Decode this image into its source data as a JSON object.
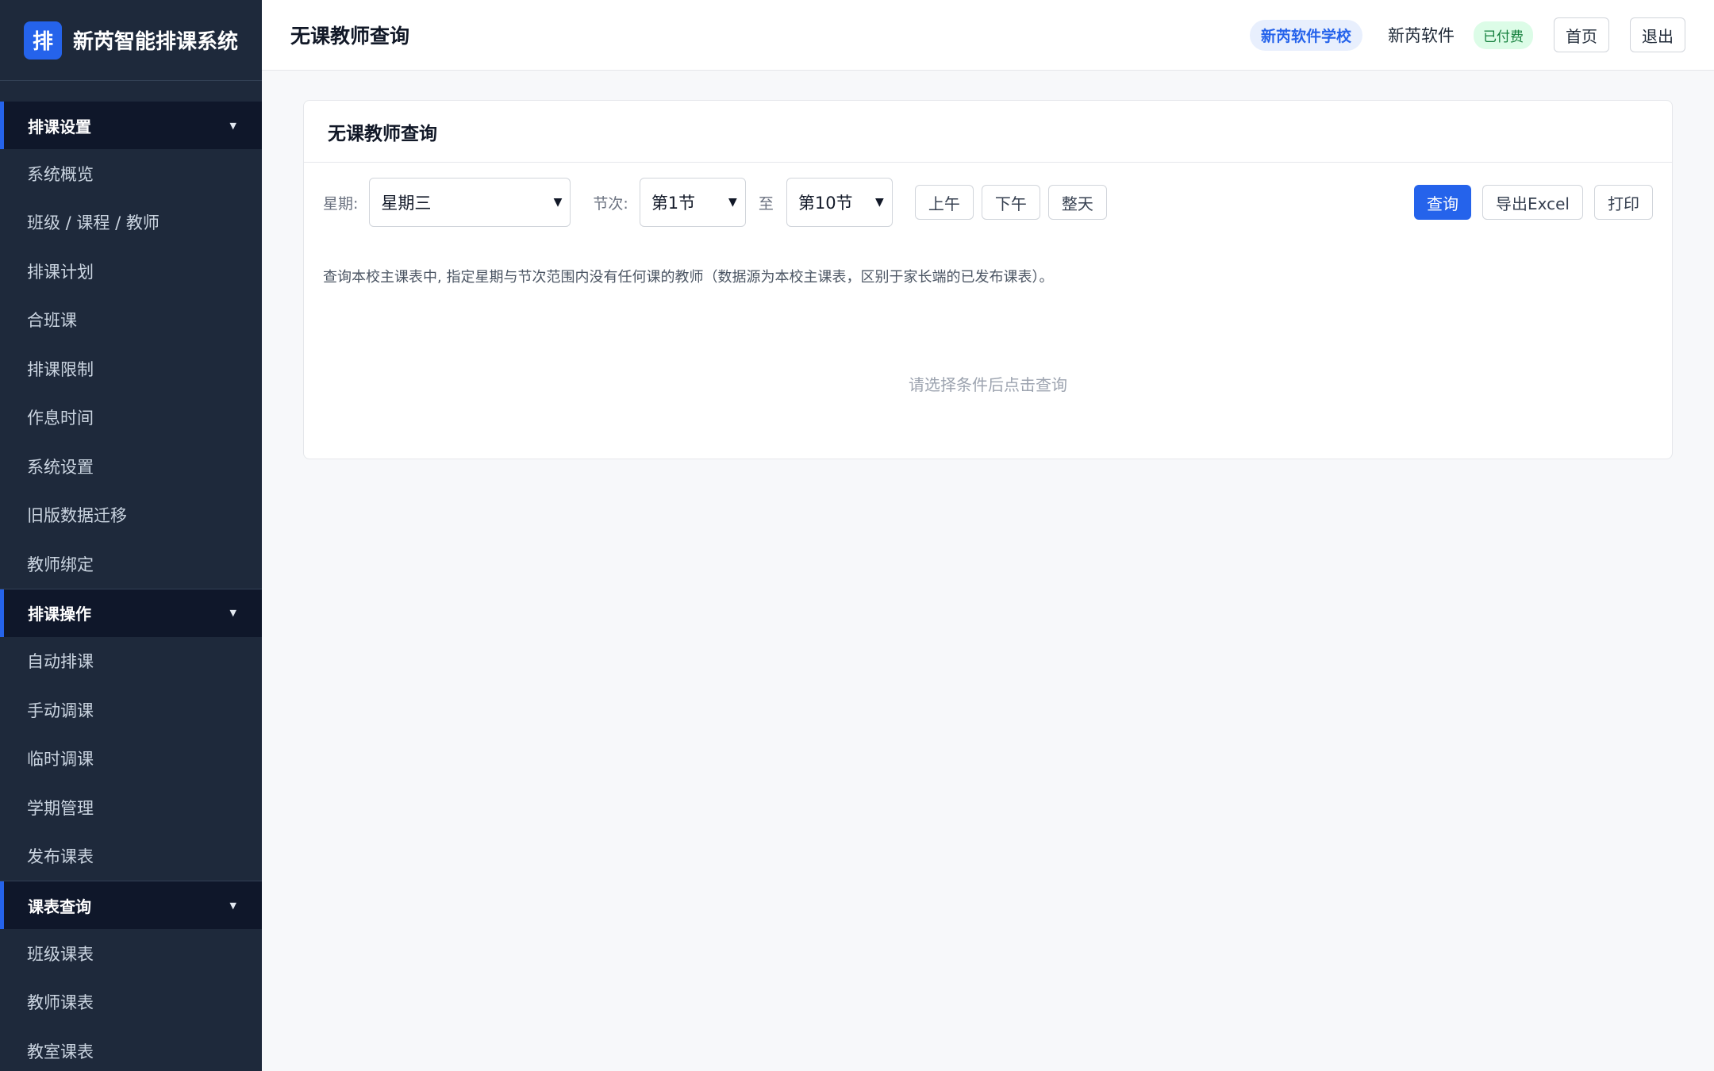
{
  "brand": {
    "logo_char": "排",
    "name": "新芮智能排课系统"
  },
  "sidebar": {
    "groups": [
      {
        "title": "排课设置",
        "items": [
          "系统概览",
          "班级 / 课程 / 教师",
          "排课计划",
          "合班课",
          "排课限制",
          "作息时间",
          "系统设置",
          "旧版数据迁移",
          "教师绑定"
        ]
      },
      {
        "title": "排课操作",
        "items": [
          "自动排课",
          "手动调课",
          "临时调课",
          "学期管理",
          "发布课表"
        ]
      },
      {
        "title": "课表查询",
        "items": [
          "班级课表",
          "教师课表",
          "教室课表"
        ]
      }
    ]
  },
  "header": {
    "title": "无课教师查询",
    "school": "新芮软件学校",
    "user": "新芮软件",
    "paid": "已付费",
    "home": "首页",
    "logout": "退出"
  },
  "card": {
    "title": "无课教师查询",
    "weekday_label": "星期:",
    "weekday_value": "星期三",
    "period_label": "节次:",
    "period_from": "第1节",
    "to_label": "至",
    "period_to": "第10节",
    "morning": "上午",
    "afternoon": "下午",
    "all_day": "整天",
    "query": "查询",
    "export": "导出Excel",
    "print": "打印",
    "description": "查询本校主课表中, 指定星期与节次范围内没有任何课的教师（数据源为本校主课表，区别于家长端的已发布课表）。",
    "empty_hint": "请选择条件后点击查询"
  }
}
